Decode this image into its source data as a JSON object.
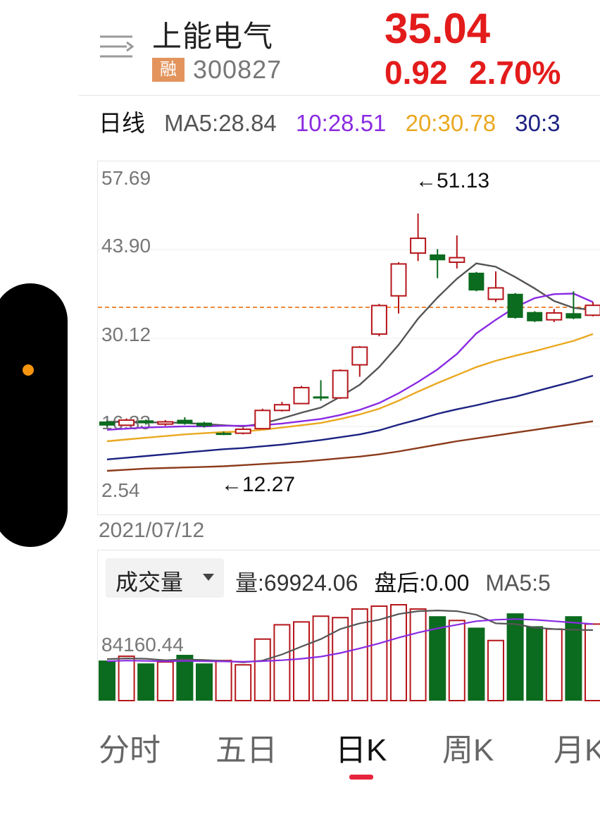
{
  "header": {
    "stock_name": "上能电气",
    "badge": "融",
    "stock_code": "300827",
    "price": "35.04",
    "change_abs": "0.92",
    "change_pct": "2.70%"
  },
  "ma_row": {
    "period_label": "日线",
    "ma5": "MA5:28.84",
    "ma10": "10:28.51",
    "ma20": "20:30.78",
    "ma30": "30:3"
  },
  "chart": {
    "y_labels": [
      "57.69",
      "43.90",
      "30.12",
      "16.33",
      "2.54"
    ],
    "high_marker": "←51.13",
    "low_marker": "←12.27",
    "start_date": "2021/07/12"
  },
  "volume": {
    "selector_label": "成交量",
    "amount": "量:69924.06",
    "after_hours": "盘后:0.00",
    "ma5": "MA5:5",
    "y_label": "84160.44"
  },
  "tabs": [
    "分时",
    "五日",
    "日K",
    "周K",
    "月K"
  ],
  "active_tab": "日K",
  "colors": {
    "up": "#b5161b",
    "down": "#0b6b1e",
    "price_red": "#e31b1b",
    "ma5": "#555555",
    "ma10": "#8a2be2",
    "ma20": "#eaa820",
    "ma30": "#1c2282",
    "ma60": "#8b3a1a",
    "accent_orange": "#f5940f",
    "tab_indicator": "#e8243c"
  },
  "chart_data": [
    {
      "type": "candlestick",
      "title": "",
      "ylim": [
        2.54,
        57.69
      ],
      "candles": [
        {
          "o": 14.6,
          "c": 14.0,
          "h": 14.8,
          "l": 13.8
        },
        {
          "o": 14.0,
          "c": 14.9,
          "h": 15.2,
          "l": 13.9
        },
        {
          "o": 14.8,
          "c": 14.4,
          "h": 15.0,
          "l": 14.1
        },
        {
          "o": 14.2,
          "c": 14.6,
          "h": 14.9,
          "l": 13.9
        },
        {
          "o": 14.9,
          "c": 14.3,
          "h": 15.4,
          "l": 14.1
        },
        {
          "o": 14.4,
          "c": 13.9,
          "h": 14.6,
          "l": 13.6
        },
        {
          "o": 12.6,
          "c": 12.5,
          "h": 12.9,
          "l": 12.27
        },
        {
          "o": 12.6,
          "c": 13.3,
          "h": 13.6,
          "l": 12.4
        },
        {
          "o": 13.4,
          "c": 16.6,
          "h": 16.9,
          "l": 13.3
        },
        {
          "o": 16.6,
          "c": 17.6,
          "h": 18.1,
          "l": 16.4
        },
        {
          "o": 17.8,
          "c": 20.6,
          "h": 20.9,
          "l": 17.7
        },
        {
          "o": 19.0,
          "c": 18.9,
          "h": 21.9,
          "l": 18.3
        },
        {
          "o": 18.8,
          "c": 23.6,
          "h": 23.8,
          "l": 18.6
        },
        {
          "o": 24.6,
          "c": 27.7,
          "h": 27.9,
          "l": 22.5
        },
        {
          "o": 30.0,
          "c": 35.0,
          "h": 35.3,
          "l": 29.6
        },
        {
          "o": 36.7,
          "c": 42.3,
          "h": 42.6,
          "l": 33.6
        },
        {
          "o": 44.2,
          "c": 46.8,
          "h": 51.13,
          "l": 42.8
        },
        {
          "o": 43.9,
          "c": 43.0,
          "h": 44.9,
          "l": 39.8
        },
        {
          "o": 42.6,
          "c": 43.4,
          "h": 47.3,
          "l": 41.5
        },
        {
          "o": 40.7,
          "c": 37.7,
          "h": 40.9,
          "l": 37.5
        },
        {
          "o": 36.1,
          "c": 38.1,
          "h": 41.0,
          "l": 35.6
        },
        {
          "o": 37.0,
          "c": 32.9,
          "h": 37.2,
          "l": 32.7
        },
        {
          "o": 33.8,
          "c": 32.3,
          "h": 34.0,
          "l": 32.1
        },
        {
          "o": 32.5,
          "c": 33.7,
          "h": 34.4,
          "l": 32.1
        },
        {
          "o": 33.6,
          "c": 32.8,
          "h": 37.5,
          "l": 32.6
        },
        {
          "o": 33.3,
          "c": 35.04,
          "h": 35.6,
          "l": 33.1
        }
      ],
      "series": [
        {
          "name": "MA5",
          "values": [
            14.6,
            14.6,
            14.5,
            14.5,
            14.4,
            14.2,
            14.0,
            13.8,
            14.3,
            15.2,
            16.2,
            17.1,
            19.0,
            21.1,
            24.2,
            28.1,
            32.7,
            36.4,
            39.7,
            42.4,
            41.8,
            40.0,
            38.0,
            35.8,
            34.6,
            34.2
          ]
        },
        {
          "name": "10",
          "values": [
            13.2,
            13.4,
            13.6,
            13.7,
            13.8,
            13.8,
            13.9,
            13.9,
            14.0,
            14.3,
            14.7,
            15.1,
            15.8,
            16.7,
            17.9,
            19.6,
            21.6,
            23.8,
            26.5,
            30.1,
            32.5,
            34.7,
            36.3,
            37.0,
            37.1,
            35.6
          ]
        },
        {
          "name": "20",
          "values": [
            11.2,
            11.5,
            11.8,
            12.1,
            12.4,
            12.6,
            12.8,
            12.9,
            13.2,
            13.6,
            14.0,
            14.4,
            15.1,
            15.9,
            16.9,
            18.3,
            19.9,
            21.4,
            22.8,
            24.2,
            25.3,
            26.2,
            27.0,
            27.9,
            28.8,
            30.0
          ]
        },
        {
          "name": "30",
          "values": [
            8.0,
            8.3,
            8.6,
            8.9,
            9.2,
            9.5,
            9.8,
            10.0,
            10.3,
            10.6,
            11.0,
            11.4,
            11.9,
            12.4,
            13.1,
            14.1,
            15.0,
            16.0,
            16.8,
            17.5,
            18.3,
            19.0,
            19.9,
            20.8,
            21.7,
            22.7
          ]
        },
        {
          "name": "",
          "values": [
            6.0,
            6.2,
            6.4,
            6.5,
            6.6,
            6.7,
            6.8,
            7.0,
            7.2,
            7.4,
            7.6,
            7.9,
            8.2,
            8.5,
            8.9,
            9.4,
            10.0,
            10.6,
            11.2,
            11.7,
            12.2,
            12.7,
            13.2,
            13.7,
            14.2,
            14.7
          ]
        }
      ]
    },
    {
      "type": "bar",
      "title": "",
      "values": [
        56000,
        62000,
        52000,
        54000,
        64000,
        52000,
        56000,
        50000,
        86000,
        106000,
        110000,
        118000,
        116000,
        128000,
        132000,
        134000,
        128000,
        118000,
        112000,
        102000,
        84000,
        122000,
        104000,
        100000,
        118000,
        107000
      ],
      "directions": [
        "down",
        "up",
        "down",
        "up",
        "down",
        "down",
        "up",
        "up",
        "up",
        "up",
        "up",
        "up",
        "up",
        "up",
        "up",
        "up",
        "up",
        "down",
        "up",
        "down",
        "up",
        "down",
        "down",
        "up",
        "down",
        "up"
      ],
      "series": [
        {
          "name": "MA5",
          "values": [
            58000,
            59000,
            58500,
            56500,
            57500,
            56800,
            55500,
            53500,
            56000,
            64500,
            75500,
            86000,
            100000,
            108000,
            113000,
            121000,
            125000,
            126000,
            125000,
            120000,
            108000,
            107000,
            102000,
            100000,
            99000,
            98500
          ]
        },
        {
          "name": "",
          "values": [
            55000,
            56000,
            55500,
            55000,
            55500,
            55000,
            54800,
            54300,
            55200,
            56500,
            58500,
            61500,
            66500,
            73000,
            80000,
            88000,
            95000,
            101000,
            106000,
            111000,
            113000,
            114000,
            113000,
            111000,
            109000,
            107000
          ]
        }
      ]
    }
  ]
}
